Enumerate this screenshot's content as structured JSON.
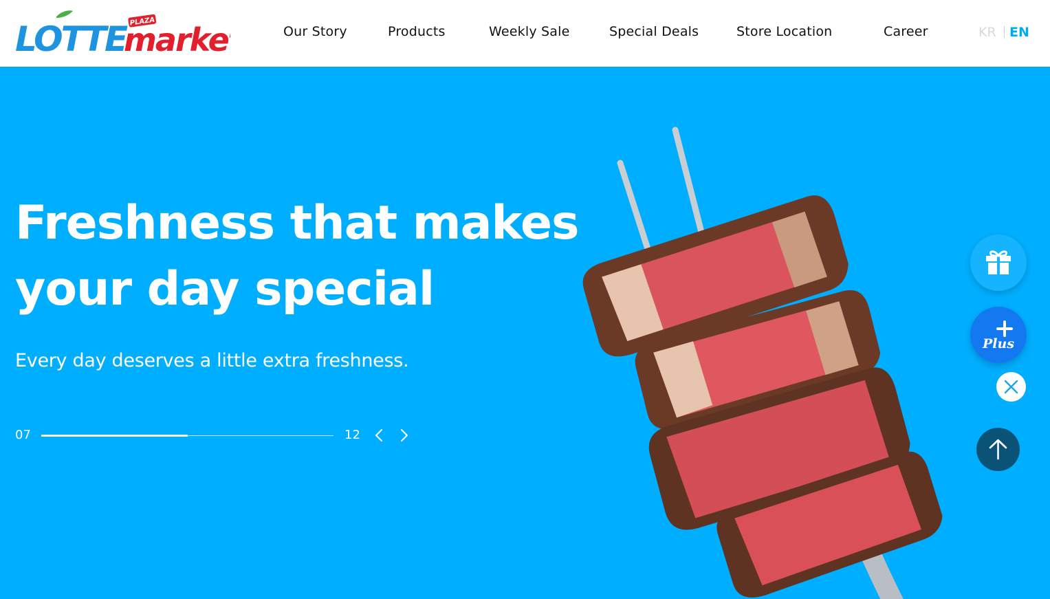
{
  "brand": {
    "logo_text": "LOTTE market",
    "logo_badge": "PLAZA",
    "colors": {
      "blue": "#1e93e0",
      "red": "#e2202d",
      "green": "#4cb048"
    }
  },
  "nav": {
    "items": [
      {
        "label": "Our Story"
      },
      {
        "label": "Products"
      },
      {
        "label": "Weekly Sale"
      },
      {
        "label": "Special Deals"
      },
      {
        "label": "Store Location"
      },
      {
        "label": "Career"
      }
    ]
  },
  "language": {
    "options": [
      "KR",
      "EN"
    ],
    "active": "EN",
    "active_color": "#00aaf3",
    "inactive_color": "#d9d9d9"
  },
  "hero": {
    "background_color": "#00aeff",
    "title_line1": "Freshness that makes",
    "title_line2": "your day special",
    "subtitle": "Every day deserves a little extra freshness.",
    "image_icon": "steak-on-fork-image"
  },
  "slider": {
    "current": "07",
    "total": "12",
    "progress_fraction": 0.5,
    "prev_icon": "chevron-left-icon",
    "next_icon": "chevron-right-icon"
  },
  "floating_buttons": {
    "gift_icon": "gift-icon",
    "plus_label": "Plus",
    "close_icon": "close-icon",
    "top_icon": "arrow-up-icon",
    "colors": {
      "gift": "#16b4ff",
      "plus": "#1479f0",
      "top": "#0b5376"
    }
  }
}
